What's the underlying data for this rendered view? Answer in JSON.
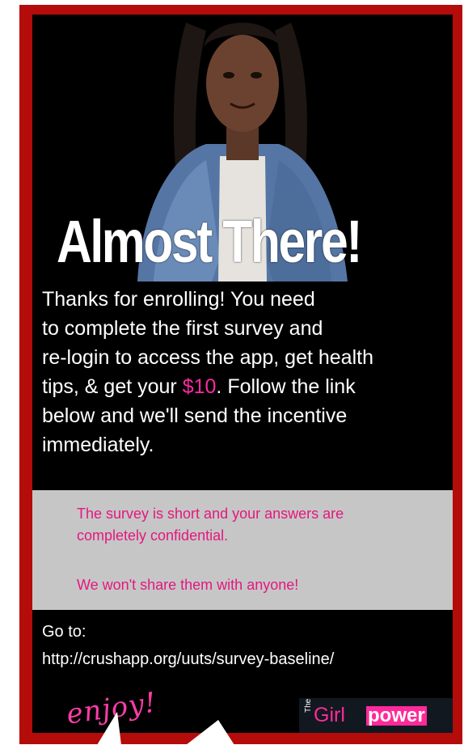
{
  "headline": "Almost There!",
  "body": {
    "line1": "Thanks for enrolling! You need",
    "line2": "to complete the first survey and",
    "line3": "re-login to access the app, get health",
    "line4_pre": "tips, & get your ",
    "line4_amount": "$10",
    "line4_post": ". Follow the link",
    "line5": "below and we'll send the incentive",
    "line6": "immediately."
  },
  "notice": {
    "line1": "The survey is short and your answers are",
    "line2": "completely confidential.",
    "line3": "We won't share them with anyone!"
  },
  "goto": {
    "label": "Go to:",
    "url": "http://crushapp.org/uuts/survey-baseline/"
  },
  "enjoy": "enjoy!",
  "brand": {
    "prefix": "The",
    "girl": "Girl",
    "power": "power"
  },
  "colors": {
    "frame": "#b40b0b",
    "accent_pink": "#e4177f",
    "panel": "#000000",
    "notice_bg": "#c6c6c6"
  }
}
